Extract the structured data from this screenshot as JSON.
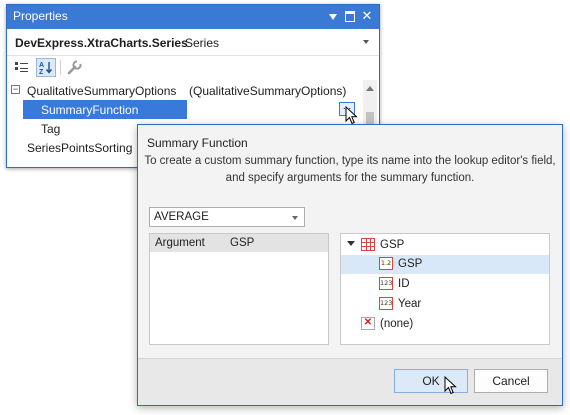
{
  "properties_window": {
    "title": "Properties",
    "object_name": "DevExpress.XtraCharts.Series",
    "object_type": "Series",
    "expander_glyph": "⊟",
    "ellipsis": "...",
    "rows": [
      {
        "label": "QualitativeSummaryOptions",
        "value": "(QualitativeSummaryOptions)"
      },
      {
        "label": "SummaryFunction",
        "value": ""
      },
      {
        "label": "Tag",
        "value": ""
      },
      {
        "label": "SeriesPointsSorting",
        "value": ""
      }
    ],
    "selected_row": "SummaryFunction",
    "toolbar": [
      "categorized-icon",
      "alphabetical-icon",
      "wrench-icon"
    ]
  },
  "dialog": {
    "title": "Summary Function",
    "info_line1": "To create a custom summary function, type its name into the lookup editor's field,",
    "info_line2": "and specify arguments for the summary function.",
    "function_value": "AVERAGE",
    "arguments": [
      {
        "name": "Argument",
        "value": "GSP"
      }
    ],
    "tree": {
      "root": "GSP",
      "fields": [
        {
          "type_badge": "1.2",
          "label": "GSP",
          "selected": true
        },
        {
          "type_badge": "123",
          "label": "ID",
          "selected": false
        },
        {
          "type_badge": "123",
          "label": "Year",
          "selected": false
        }
      ],
      "none_label": "(none)",
      "none_icon": "✕"
    },
    "ok_label": "OK",
    "cancel_label": "Cancel"
  },
  "colors": {
    "title_bar": "#3a79d4",
    "selection": "#3879d9",
    "tree_selection": "#d9e8f8",
    "field_icon_red": "#d24a3a"
  }
}
